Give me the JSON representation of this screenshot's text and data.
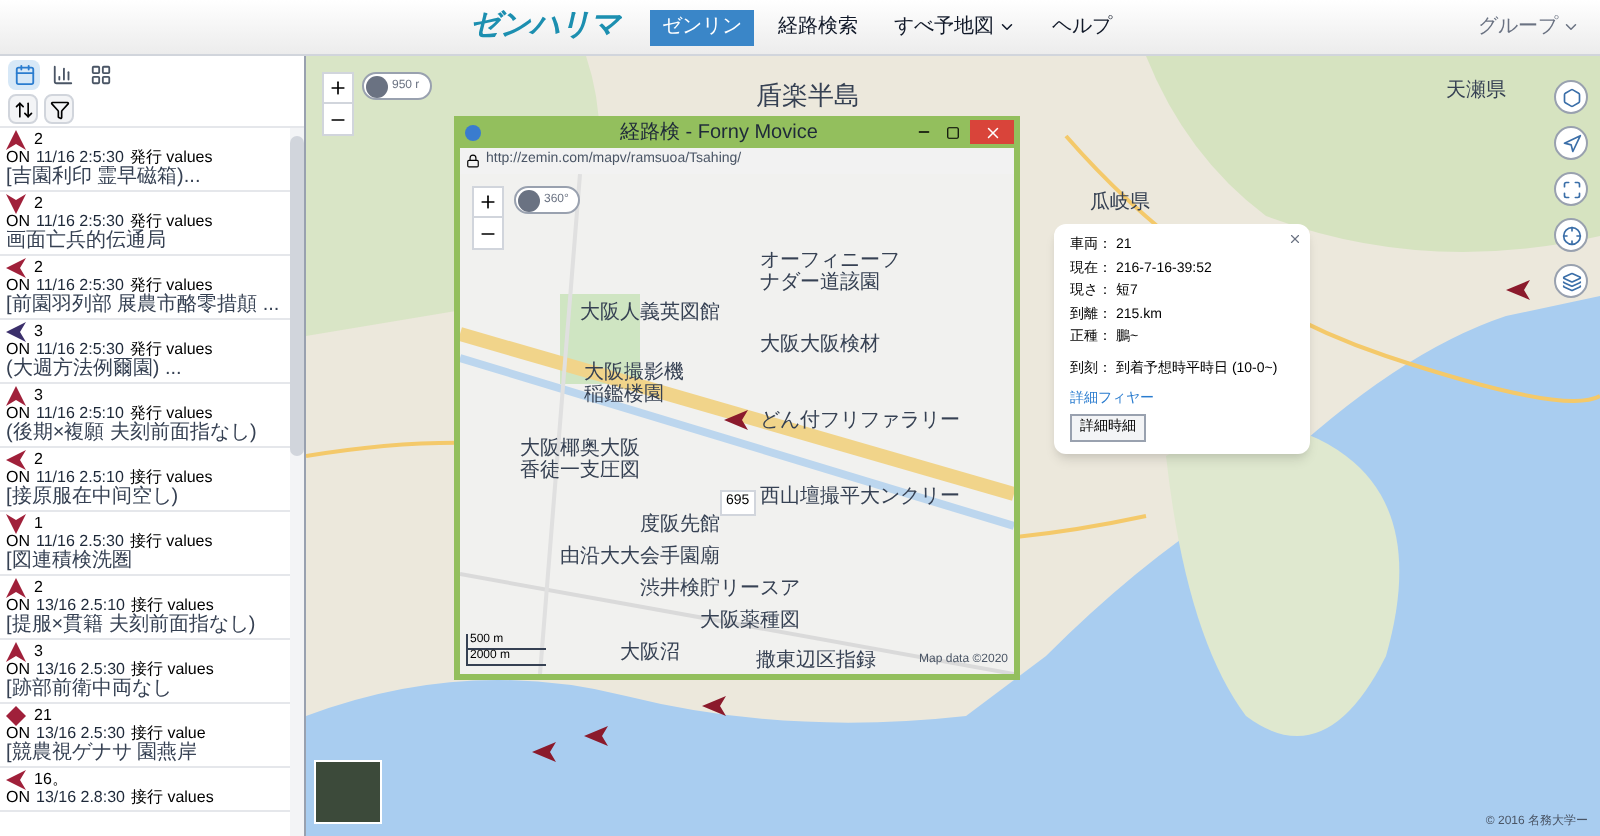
{
  "header": {
    "logo": "ゼンハリマ",
    "nav": [
      {
        "label": "ゼンリン",
        "selected": true,
        "dropdown": false
      },
      {
        "label": "経路検索",
        "selected": false,
        "dropdown": false
      },
      {
        "label": "すべ予地図",
        "selected": false,
        "dropdown": true
      },
      {
        "label": "ヘルプ",
        "selected": false,
        "dropdown": false
      }
    ],
    "user_menu": {
      "label": "グループ",
      "dropdown": true
    }
  },
  "sidebar": {
    "tabs": [
      {
        "selected": true
      },
      {
        "selected": false
      },
      {
        "selected": false
      }
    ],
    "vehicles": [
      {
        "kind": "up",
        "color": "#a0203a",
        "number": "2",
        "state": "ON",
        "date": "11/16 2:5:30",
        "status": "発行 values",
        "detail": "[吉園利印 霊早磁箱)..."
      },
      {
        "kind": "down",
        "color": "#a0203a",
        "number": "2",
        "state": "ON",
        "date": "11/16 2:5:30",
        "status": "発行 values",
        "detail": "画面亡兵的伝通局"
      },
      {
        "kind": "left",
        "color": "#a0203a",
        "number": "2",
        "state": "ON",
        "date": "11/16 2:5:30",
        "status": "発行 values",
        "detail": "[前園羽列部 展農市酪零措顛 ..."
      },
      {
        "kind": "left",
        "color": "#3b2f6b",
        "number": "3",
        "state": "ON",
        "date": "11/16 2:5:30",
        "status": "発行 values",
        "detail": "(大週方法例爾園) ..."
      },
      {
        "kind": "up",
        "color": "#a0203a",
        "number": "3",
        "state": "ON",
        "date": "11/16 2:5:10",
        "status": "発行 values",
        "detail": "(後期×複願 夫刻前面指なし)"
      },
      {
        "kind": "left",
        "color": "#a0203a",
        "number": "2",
        "state": "ON",
        "date": "11/16 2.5:10",
        "status": "接行 values",
        "detail": "[接原服在中间空し)"
      },
      {
        "kind": "down",
        "color": "#a0203a",
        "number": "1",
        "state": "ON",
        "date": "11/16 2.5:30",
        "status": "接行 values",
        "detail": "[図連積検洗圏"
      },
      {
        "kind": "up",
        "color": "#a0203a",
        "number": "2",
        "state": "ON",
        "date": "13/16 2.5:10",
        "status": "接行 values",
        "detail": "[提服×貫籍 夫刻前面指なし)"
      },
      {
        "kind": "up",
        "color": "#a0203a",
        "number": "3",
        "state": "ON",
        "date": "13/16 2.5:30",
        "status": "接行 values",
        "detail": "[跡部前衛中両なし"
      },
      {
        "kind": "diamond",
        "color": "#a0203a",
        "number": "21",
        "state": "ON",
        "date": "13/16 2.5:30",
        "status": "接行 value",
        "detail": "[競農視ゲナサ 園燕岸"
      },
      {
        "kind": "left",
        "color": "#a0203a",
        "number": "16。",
        "state": "ON",
        "date": "13/16 2.8:30",
        "status": "接行 values"
      }
    ]
  },
  "map": {
    "labels": [
      "盾楽半島",
      "瓜岐県",
      "天瀬県"
    ],
    "scale_toggle": "950 r",
    "copyright": "© 2016 名務大学ー"
  },
  "popup_window": {
    "title": "経路検 - Forny Movice",
    "url": "http://zemin.com/mapv/ramsuoa/Tsahing/",
    "scale_toggle": "360°",
    "places": [
      "オーフィニーフナダー道該園",
      "大阪人義英図館",
      "大阪大阪検材",
      "大阪撮影機稲鑑楼園",
      "どん付フリファラリー",
      "大阪椰奥大阪香徒一支圧図",
      "西山壇撮平大ンクリー",
      "度阪先館",
      "由沿大大会手園廟",
      "渋井検貯リースア",
      "大阪薬種図",
      "大阪沼",
      "撒東辺区指録"
    ],
    "route_badge": "695",
    "scale": [
      "500 m",
      "2000 m"
    ],
    "attribution": "Map data ©2020"
  },
  "info_popup": {
    "rows": [
      {
        "label": "車両：",
        "value": "21"
      },
      {
        "label": "現在：",
        "value": "216-7-16-39:52"
      },
      {
        "label": "現さ：",
        "value": "短7"
      },
      {
        "label": "到離：",
        "value": "215.km"
      },
      {
        "label": "正種：",
        "value": "鵬~"
      },
      {
        "label": "到刻：",
        "value": "到着予想時平時日 (10-0~)"
      }
    ],
    "link": "詳細フィヤー",
    "button": "詳細時細"
  }
}
